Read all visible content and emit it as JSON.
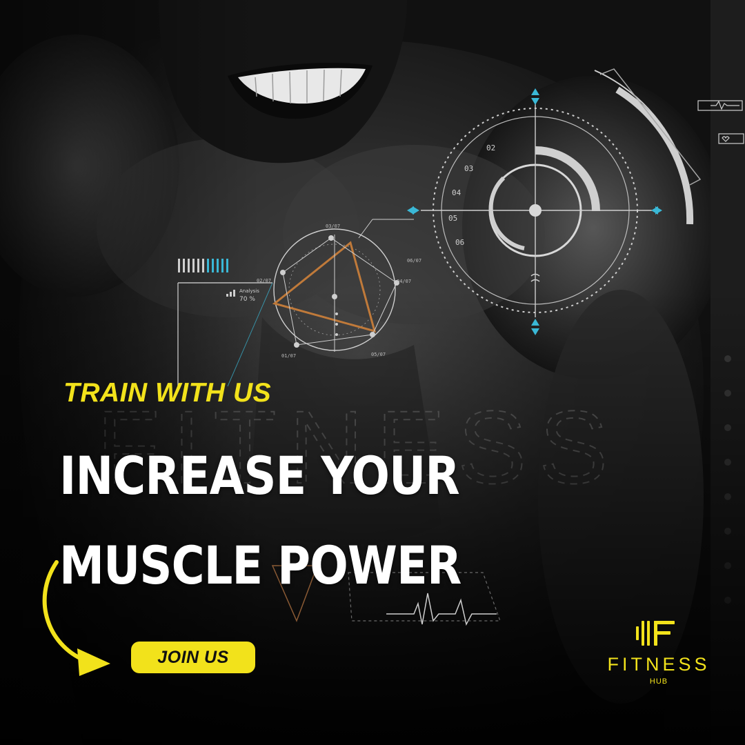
{
  "tagline": "TRAIN WITH US",
  "headline": {
    "line1": "INCREASE YOUR",
    "line2": "MUSCLE POWER"
  },
  "cta": {
    "label": "JOIN US"
  },
  "brand": {
    "name": "FITNESS",
    "sub": "HUB",
    "icon": "fitness-hub-logo-icon"
  },
  "hud": {
    "dial_ticks": [
      "02",
      "03",
      "04",
      "05",
      "06"
    ],
    "analysis_label": "Analysis",
    "analysis_value": "70 %",
    "node_labels": [
      "01/07",
      "02/07",
      "03/07",
      "04/07",
      "05/07",
      "06/07"
    ]
  },
  "colors": {
    "accent_yellow": "#f2e21b",
    "hud_cyan": "#3ab8d6",
    "hud_orange": "#c07a3a",
    "background": "#0b0b0b"
  },
  "background_subject": "muscular-man-photo"
}
